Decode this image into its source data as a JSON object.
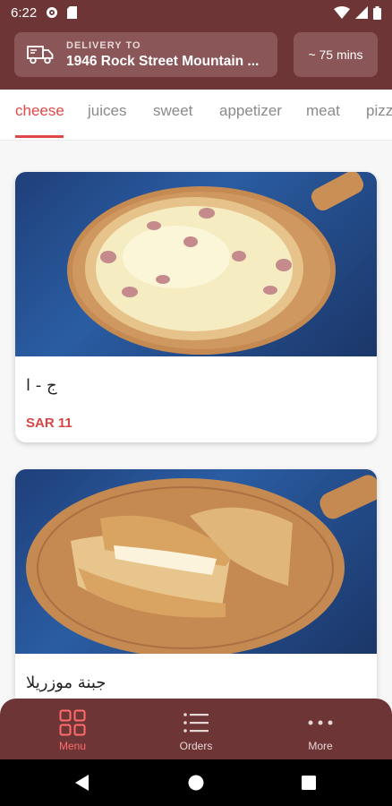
{
  "status": {
    "time": "6:22"
  },
  "header": {
    "delivery_label": "DELIVERY TO",
    "address": "1946 Rock Street Mountain ...",
    "eta": "~ 75 mins"
  },
  "tabs": [
    {
      "label": "cheese",
      "active": true
    },
    {
      "label": "juices"
    },
    {
      "label": "sweet"
    },
    {
      "label": "appetizer"
    },
    {
      "label": "meat"
    },
    {
      "label": "pizz"
    }
  ],
  "items": [
    {
      "name": "ج - ا",
      "price": "SAR 11"
    },
    {
      "name": "جبنة موزريلا"
    }
  ],
  "bottom_nav": [
    {
      "label": "Menu",
      "icon": "grid-icon",
      "active": true
    },
    {
      "label": "Orders",
      "icon": "list-icon"
    },
    {
      "label": "More",
      "icon": "more-dots-icon"
    }
  ],
  "colors": {
    "brand": "#6e3537",
    "accent": "#e04848",
    "price": "#d64545"
  }
}
